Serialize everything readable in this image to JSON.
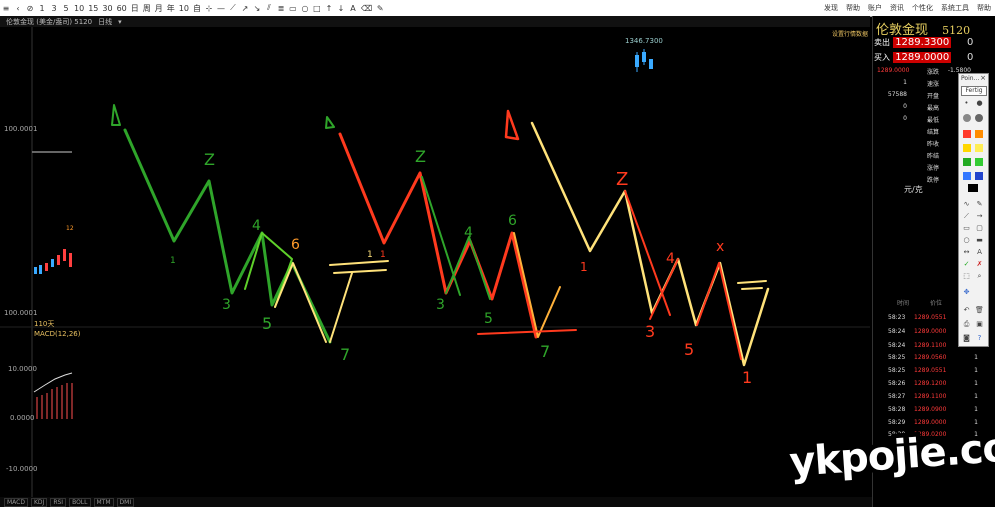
{
  "toolbar": {
    "periods": [
      "1",
      "3",
      "5",
      "10",
      "15",
      "30",
      "60",
      "日",
      "周",
      "月",
      "年",
      "10",
      "自"
    ],
    "menus": [
      "发现",
      "帮助",
      "账户",
      "资讯",
      "个性化",
      "系统工具",
      "帮助"
    ]
  },
  "subbar": {
    "instrument": "伦敦金现 (美金/盎司) 5120",
    "period": "日线"
  },
  "chart": {
    "y_labels": [
      "100.0001",
      "100.0001",
      "110天",
      "MACD(12,26)",
      "10.0000",
      "0.0000",
      "-10.0000"
    ],
    "annotation": "1346.7300",
    "legend_tag": "设置行情数据",
    "marker_labels": [
      "1",
      "12"
    ]
  },
  "bottom_tabs": [
    "MACD",
    "KDJ",
    "RSI",
    "BOLL",
    "MTM",
    "DMI"
  ],
  "right_panel": {
    "title": "伦敦金现",
    "code": "5120",
    "sell_label": "卖出",
    "sell_price": "1289.3300",
    "sell_qty": "0",
    "buy_label": "买入",
    "buy_price": "1289.0000",
    "buy_qty": "0",
    "quote_rows": [
      {
        "left": "1289.0000",
        "label": "涨跌",
        "value": "-1.5800"
      },
      {
        "left": "1",
        "label": "速涨",
        "value": ""
      },
      {
        "left": "57588",
        "label": "开盘",
        "value": ""
      },
      {
        "left": "0",
        "label": "最高",
        "value": ""
      },
      {
        "left": "0",
        "label": "最低",
        "value": ""
      },
      {
        "left": "",
        "label": "结算",
        "value": ""
      },
      {
        "left": "",
        "label": "昨收",
        "value": ""
      },
      {
        "left": "",
        "label": "昨结",
        "value": ""
      },
      {
        "left": "",
        "label": "涨停",
        "value": ""
      },
      {
        "left": "",
        "label": "跌停",
        "value": ""
      }
    ],
    "unit_label": "元/克",
    "trade_header": [
      "时间",
      "价位"
    ],
    "trades": [
      {
        "time": "58:23",
        "price": "1289.0551",
        "vol": "1"
      },
      {
        "time": "58:24",
        "price": "1289.0000",
        "vol": "1"
      },
      {
        "time": "58:24",
        "price": "1289.1100",
        "vol": "1"
      },
      {
        "time": "58:25",
        "price": "1289.0560",
        "vol": "1"
      },
      {
        "time": "58:25",
        "price": "1289.0551",
        "vol": "1"
      },
      {
        "time": "58:26",
        "price": "1289.1200",
        "vol": "1"
      },
      {
        "time": "58:27",
        "price": "1289.1100",
        "vol": "1"
      },
      {
        "time": "58:28",
        "price": "1289.0900",
        "vol": "1"
      },
      {
        "time": "58:29",
        "price": "1289.0000",
        "vol": "1"
      },
      {
        "time": "58:29",
        "price": "1289.0200",
        "vol": "1"
      }
    ]
  },
  "palette": {
    "title": "Poin...",
    "preset": "Fertig",
    "swatches": [
      "#ffffff",
      "#888888",
      "#ff3a2a",
      "#ff8c00",
      "#ffd700",
      "#ffee55",
      "#22aa22",
      "#33cc33",
      "#3377ff",
      "#2244cc",
      "#000000"
    ]
  },
  "watermark": "ykpojie.com",
  "colors": {
    "green": "#2fa52a",
    "red": "#ff3a1e",
    "orange": "#ffb13a",
    "yellow": "#ffe27a"
  }
}
